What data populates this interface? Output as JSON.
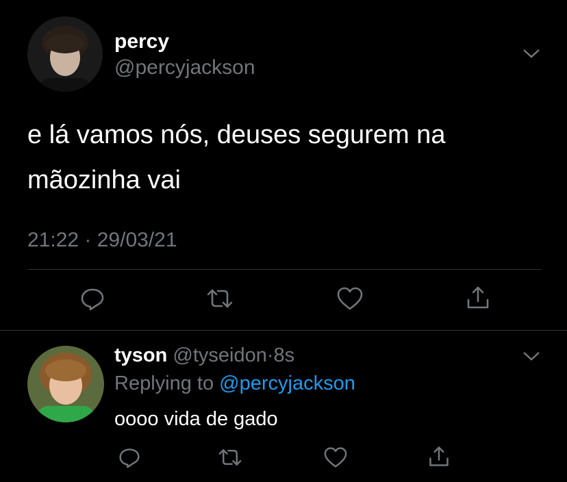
{
  "main_tweet": {
    "display_name": "percy",
    "handle": "@percyjackson",
    "text_line1": "e lá vamos nós, deuses segurem na",
    "text_line2": "mãozinha vai",
    "timestamp": "21:22 · 29/03/21"
  },
  "reply_tweet": {
    "display_name": "tyson",
    "handle": "@tyseidon",
    "separator": "·",
    "age": "8s",
    "replying_prefix": "Replying to",
    "replying_handle": "@percyjackson",
    "text": "oooo vida de gado"
  },
  "colors": {
    "background": "#000000",
    "text": "#ffffff",
    "muted": "#71767b",
    "link": "#1d9bf0",
    "divider": "#2f3336"
  },
  "icons": [
    "chevron-down-icon",
    "reply-icon",
    "retweet-icon",
    "like-icon",
    "share-icon"
  ]
}
